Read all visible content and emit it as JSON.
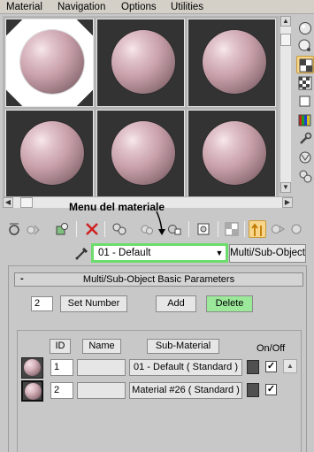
{
  "menubar": {
    "items": [
      "Material",
      "Navigation",
      "Options",
      "Utilities"
    ]
  },
  "slots": {
    "count": 6,
    "active_index": 0
  },
  "annotation": {
    "text": "Menu del materiale"
  },
  "material": {
    "name": "01 - Default",
    "type_button": "Multi/Sub-Object"
  },
  "rollout": {
    "collapse_symbol": "-",
    "title": "Multi/Sub-Object Basic Parameters",
    "count": "2",
    "set_number_label": "Set Number",
    "add_label": "Add",
    "delete_label": "Delete",
    "delete_color": "#9be89b",
    "columns": {
      "id": "ID",
      "name": "Name",
      "sub_material": "Sub-Material",
      "on_off": "On/Off"
    },
    "rows": [
      {
        "id": "1",
        "name": "",
        "sub_material": "01 - Default  ( Standard )",
        "on": true,
        "selected": false
      },
      {
        "id": "2",
        "name": "",
        "sub_material": "Material #26  ( Standard )",
        "on": true,
        "selected": true
      }
    ]
  },
  "colors": {
    "highlight_green": "#6cdc6c",
    "pressed_tool": "#f7d68b",
    "sphere_pink": "#c8a0aa"
  }
}
